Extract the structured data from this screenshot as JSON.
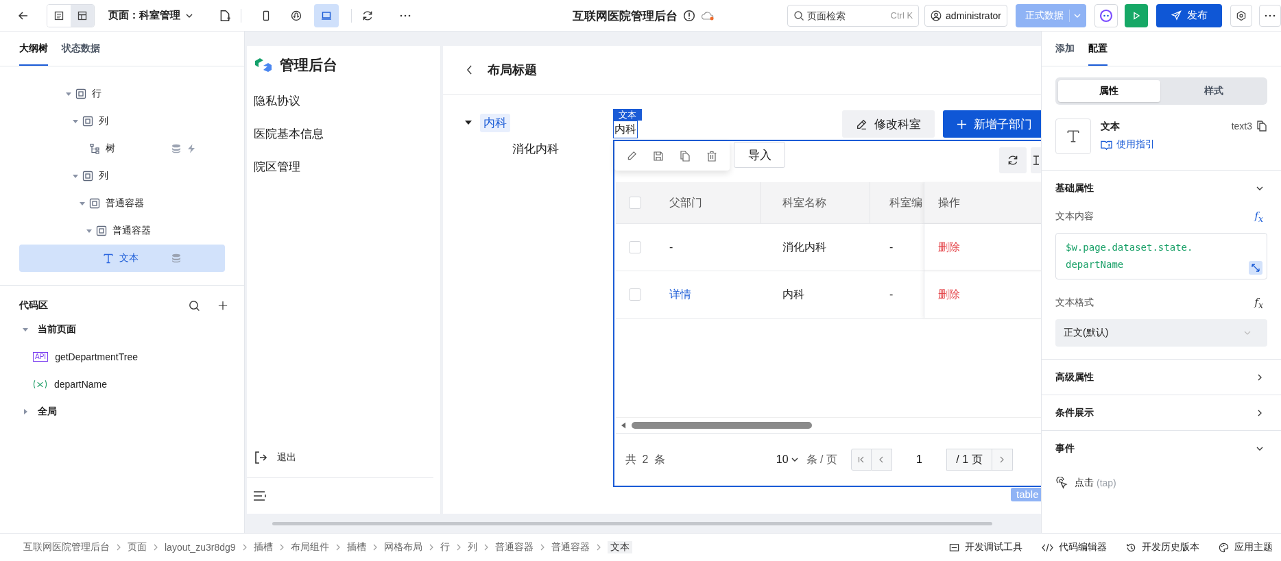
{
  "toolbar": {
    "view_modes": [
      {
        "kind": "page",
        "selected": false
      },
      {
        "kind": "layout",
        "selected": true
      }
    ],
    "page_selector": "页面：科室管理",
    "device_views": [
      {
        "kind": "phone",
        "selected": false
      },
      {
        "kind": "miniprogram",
        "selected": false
      },
      {
        "kind": "desktop",
        "selected": true
      }
    ],
    "title": "互联网医院管理后台",
    "search": {
      "placeholder": "页面检索",
      "shortcut": "Ctrl K"
    },
    "user": "administrator",
    "env": {
      "label": "正式数据",
      "disabled": true
    },
    "publish": "发布"
  },
  "left_panel": {
    "tabs": [
      {
        "label": "大纲树",
        "selected": true
      },
      {
        "label": "状态数据",
        "selected": false
      }
    ],
    "outline": [
      {
        "label": "行",
        "kind": "container",
        "expanded": true,
        "selected": false,
        "has_data": false,
        "has_event": false,
        "children": [
          {
            "label": "列",
            "kind": "container",
            "expanded": true,
            "selected": false,
            "has_data": false,
            "has_event": false,
            "children": [
              {
                "label": "树",
                "kind": "tree",
                "selected": false,
                "has_data": true,
                "has_event": true
              }
            ]
          },
          {
            "label": "列",
            "kind": "container",
            "expanded": true,
            "selected": false,
            "has_data": false,
            "has_event": false,
            "children": [
              {
                "label": "普通容器",
                "kind": "container",
                "expanded": true,
                "selected": false,
                "has_data": false,
                "has_event": false,
                "children": [
                  {
                    "label": "普通容器",
                    "kind": "container",
                    "expanded": true,
                    "selected": false,
                    "has_data": false,
                    "has_event": false,
                    "children": [
                      {
                        "label": "文本",
                        "kind": "text",
                        "selected": true,
                        "has_data": true,
                        "has_event": false
                      }
                    ]
                  }
                ]
              }
            ]
          }
        ]
      }
    ],
    "code_area": {
      "title": "代码区",
      "groups": [
        {
          "label": "当前页面",
          "expanded": true,
          "items": [
            {
              "kind": "api",
              "badge": "API",
              "name": "getDepartmentTree"
            },
            {
              "kind": "variable",
              "name": "departName"
            }
          ]
        },
        {
          "label": "全局",
          "expanded": false
        }
      ]
    }
  },
  "preview": {
    "brand": "管理后台",
    "menu": [
      "隐私协议",
      "医院基本信息",
      "院区管理"
    ],
    "logout": "退出",
    "header_title": "布局标题",
    "dept_tree": [
      {
        "label": "内科",
        "expanded": true,
        "selected": true,
        "children": [
          {
            "label": "消化内科",
            "selected": false
          }
        ]
      }
    ],
    "selection_tag": "文本",
    "selected_text": "内科",
    "buttons": [
      {
        "label": "修改科室",
        "kind": "secondary"
      },
      {
        "label": "新增子部门",
        "kind": "primary"
      }
    ],
    "table": {
      "import_button": "导入",
      "columns": [
        "父部门",
        "科室名称",
        "科室编",
        "操作"
      ],
      "header_checked": false,
      "rows": [
        {
          "checked": false,
          "cells": [
            {
              "kind": "text",
              "text": "-"
            },
            {
              "kind": "text",
              "text": "消化内科"
            },
            {
              "kind": "text",
              "text": "-"
            },
            {
              "kind": "danger",
              "text": "删除"
            }
          ]
        },
        {
          "checked": false,
          "cells": [
            {
              "kind": "link",
              "text": "详情"
            },
            {
              "kind": "text",
              "text": "内科"
            },
            {
              "kind": "text",
              "text": "-"
            },
            {
              "kind": "danger",
              "text": "删除"
            }
          ]
        }
      ],
      "total": "共 2 条",
      "page_size": "10",
      "per_page": "条 / 页",
      "page": "1",
      "pages": "/ 1 页",
      "tag": "table"
    }
  },
  "right_panel": {
    "tabs": [
      {
        "label": "添加",
        "selected": false
      },
      {
        "label": "配置",
        "selected": true
      }
    ],
    "segments": [
      {
        "label": "属性",
        "selected": true
      },
      {
        "label": "样式",
        "selected": false
      }
    ],
    "component": {
      "name": "文本",
      "guide": "使用指引",
      "id": "text3"
    },
    "sections": [
      {
        "title": "基础属性",
        "expanded": true,
        "fields": [
          {
            "label": "文本内容",
            "formula": "f$_{x}$",
            "formula_bound": true,
            "kind": "code",
            "value": "$w.page.dataset.state.departName"
          },
          {
            "label": "文本格式",
            "formula": "f$_{x}$",
            "formula_bound": false,
            "kind": "select",
            "value": "正文(默认)"
          }
        ]
      },
      {
        "title": "高级属性",
        "expanded": false
      },
      {
        "title": "条件展示",
        "expanded": false
      },
      {
        "title": "事件",
        "expanded": true,
        "events": [
          {
            "label": "点击",
            "hint": "(tap)"
          }
        ]
      }
    ]
  },
  "status_bar": {
    "breadcrumb": [
      "互联网医院管理后台",
      "页面",
      "layout_zu3r8dg9",
      "插槽",
      "布局组件",
      "插槽",
      "网格布局",
      "行",
      "列",
      "普通容器",
      "普通容器",
      "文本"
    ],
    "tools": [
      {
        "kind": "debug",
        "label": "开发调试工具"
      },
      {
        "kind": "code",
        "label": "代码编辑器"
      },
      {
        "kind": "history",
        "label": "开发历史版本"
      },
      {
        "kind": "theme",
        "label": "应用主题"
      }
    ]
  }
}
